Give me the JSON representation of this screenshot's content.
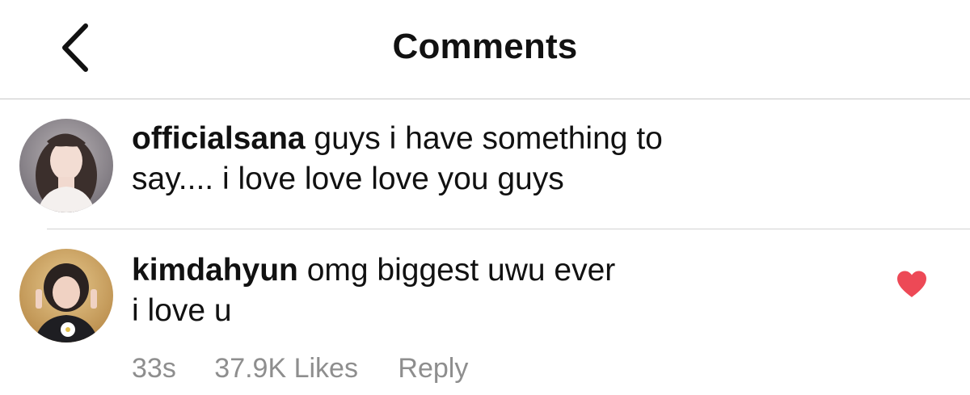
{
  "header": {
    "title": "Comments",
    "back_icon": "chevron-left-icon"
  },
  "comments": [
    {
      "username": "officialsana",
      "text_line1": "guys i have something to",
      "text_line2": "say.... i love love love you guys"
    },
    {
      "username": "kimdahyun",
      "text_line1": "omg biggest uwu ever",
      "text_line2": "i love u",
      "liked": true,
      "like_icon": "heart-filled-icon",
      "time": "33s",
      "likes": "37.9K Likes",
      "reply_label": "Reply"
    }
  ],
  "colors": {
    "text": "#111111",
    "meta": "#8e8e8e",
    "divider": "#c8c8c8",
    "heart": "#ed4956"
  }
}
